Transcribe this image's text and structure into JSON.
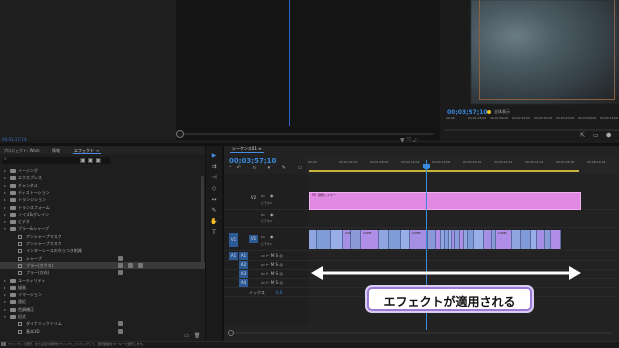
{
  "source_monitor": {
    "timecode": "00;01;17;14",
    "tools": "▼ ⤧ ⤦"
  },
  "program_monitor": {
    "timecode": "00;03;57;10",
    "zoom": "全体表示",
    "ruler": [
      "00;00",
      "00;01;28;00",
      "00;01;56;00",
      "00;02;24;00",
      "00;02;52;00",
      "00;03;20;00",
      "00;03;48;00",
      "00;04;16;00"
    ],
    "buttons": [
      "⇱",
      "▭",
      "⬢"
    ]
  },
  "effects_panel": {
    "tabs": {
      "project": "プロジェクト: Work",
      "info": "情報",
      "effects": "エフェクト",
      "menu": "≡"
    },
    "search_placeholder": "",
    "rows": [
      {
        "label": "イージング",
        "kind": "folder",
        "indent": 1
      },
      {
        "label": "エクスプレス",
        "kind": "folder",
        "indent": 1
      },
      {
        "label": "チャンネル",
        "kind": "folder",
        "indent": 1
      },
      {
        "label": "ディストーション",
        "kind": "folder",
        "indent": 1
      },
      {
        "label": "トランジション",
        "kind": "folder",
        "indent": 1
      },
      {
        "label": "トランスフォーム",
        "kind": "folder",
        "indent": 1
      },
      {
        "label": "ノイズ&グレイン",
        "kind": "folder",
        "indent": 1
      },
      {
        "label": "ビデオ",
        "kind": "folder",
        "indent": 1
      },
      {
        "label": "ブラー&シャープ",
        "kind": "folder-open",
        "indent": 1
      },
      {
        "label": "アンシャープマスク",
        "kind": "item",
        "indent": 2
      },
      {
        "label": "アンシャープマスク",
        "kind": "item",
        "indent": 2
      },
      {
        "label": "インターレースのちらつき削減",
        "kind": "item",
        "indent": 2
      },
      {
        "label": "シャープ",
        "kind": "item",
        "indent": 2,
        "badges": 1
      },
      {
        "label": "ブラー(ガウス)",
        "kind": "item",
        "indent": 2,
        "badges": 3,
        "selected": true
      },
      {
        "label": "ブラー(方向)",
        "kind": "item",
        "indent": 2,
        "badges": 1
      },
      {
        "label": "ユーティリティ",
        "kind": "folder",
        "indent": 1
      },
      {
        "label": "描画",
        "kind": "folder",
        "indent": 1
      },
      {
        "label": "イマージョン",
        "kind": "folder",
        "indent": 1
      },
      {
        "label": "遠近",
        "kind": "folder",
        "indent": 1
      },
      {
        "label": "色調補正",
        "kind": "folder",
        "indent": 1
      },
      {
        "label": "旧式",
        "kind": "folder-open",
        "indent": 1
      },
      {
        "label": "ダイナミックトリム",
        "kind": "item",
        "indent": 2,
        "badges": 1
      },
      {
        "label": "基本3D",
        "kind": "item",
        "indent": 2,
        "badges": 1
      }
    ]
  },
  "timeline": {
    "tab_label": "シーケンス01",
    "tab_menu": "≡",
    "timecode": "00;03;57;10",
    "ruler": [
      "00;00",
      "00;01;04;02",
      "00;01;48;04",
      "00;02;12;06",
      "00;04;16;08",
      "00;04;56;10",
      "00;05;44;12",
      "00;06;32;14",
      "00;07;08;16",
      "00;08;10;18"
    ],
    "tracks": {
      "v2": {
        "name": "V2",
        "label": "ビデオ2"
      },
      "v1": {
        "name": "V1",
        "label": "ビデオ1",
        "source": "V1"
      },
      "a1": {
        "name": "A1",
        "source": "A1"
      },
      "a2": {
        "name": "A2"
      },
      "a3": {
        "name": "A3"
      },
      "a4": {
        "name": "A4"
      },
      "mix": {
        "name": "ミックス",
        "value": "0.0"
      }
    },
    "adjustment_clip_label": "調整レイヤー",
    "video_clip_labels": [
      "C2PM",
      "C2PM",
      "C2PM",
      "C2PM"
    ],
    "annotation": "エフェクトが適用される"
  },
  "status_bar": {
    "text": "クリックして選択、または空の場所をクリックしてドラッグして、選択範囲をマーキーで選択します。"
  },
  "colors": {
    "accent": "#3a8be0",
    "adjustment_clip": "#e089e0",
    "video_clip": "#8a9ad8",
    "annotation_border": "#9b7ad8"
  }
}
